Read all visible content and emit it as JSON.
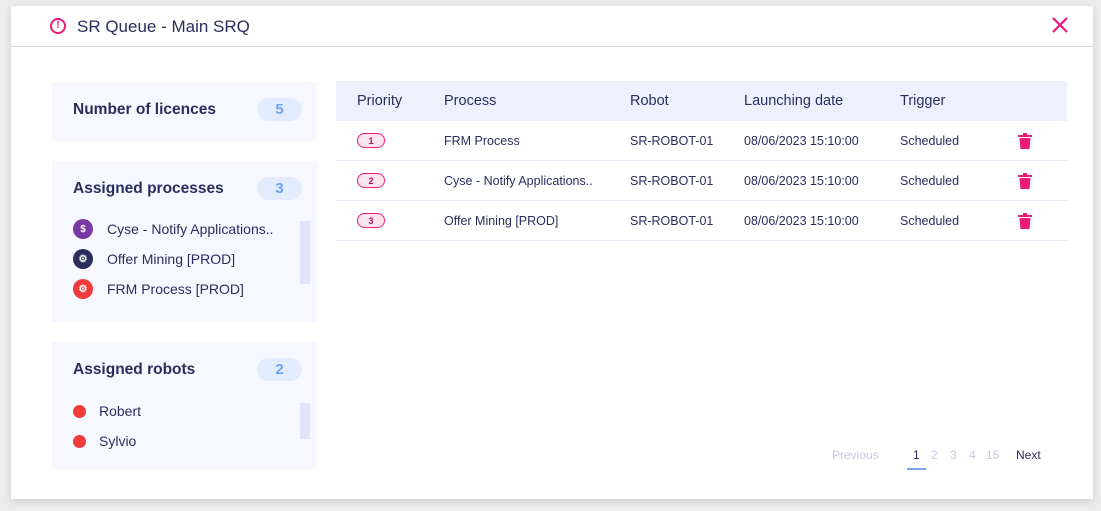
{
  "header": {
    "title": "SR Queue - Main SRQ",
    "alert_icon": "!",
    "close_label": "close"
  },
  "licences": {
    "label": "Number of licences",
    "count": "5"
  },
  "processes": {
    "label": "Assigned processes",
    "count": "3",
    "items": [
      {
        "name": "Cyse - Notify Applications..",
        "icon": "$",
        "icon_name": "dollar-icon",
        "color": "#7a3aa5"
      },
      {
        "name": "Offer Mining [PROD]",
        "icon": "⚙",
        "icon_name": "people-gear-icon",
        "color": "#2b2d5c"
      },
      {
        "name": "FRM Process [PROD]",
        "icon": "⚙",
        "icon_name": "people-gear-icon",
        "color": "#f03b3b"
      }
    ]
  },
  "robots": {
    "label": "Assigned robots",
    "count": "2",
    "items": [
      {
        "name": "Robert",
        "status_color": "#f03b3b"
      },
      {
        "name": "Sylvio",
        "status_color": "#f03b3b"
      }
    ]
  },
  "table": {
    "columns": [
      "Priority",
      "Process",
      "Robot",
      "Launching date",
      "Trigger"
    ],
    "rows": [
      {
        "priority": "1",
        "process": "FRM Process",
        "robot": "SR-ROBOT-01",
        "date": "08/06/2023 15:10:00",
        "trigger": "Scheduled"
      },
      {
        "priority": "2",
        "process": "Cyse - Notify Applications..",
        "robot": "SR-ROBOT-01",
        "date": "08/06/2023 15:10:00",
        "trigger": "Scheduled"
      },
      {
        "priority": "3",
        "process": "Offer Mining [PROD]",
        "robot": "SR-ROBOT-01",
        "date": "08/06/2023 15:10:00",
        "trigger": "Scheduled"
      }
    ]
  },
  "pagination": {
    "previous": "Previous",
    "next": "Next",
    "pages": [
      "1",
      "2",
      "3",
      "4",
      "15"
    ],
    "current": "1"
  },
  "colors": {
    "accent": "#ee1a7a",
    "text": "#2b2d5c",
    "count_badge_bg": "#e3ecfd",
    "count_badge_text": "#6da4ef",
    "table_header_bg": "#eef1fd"
  }
}
